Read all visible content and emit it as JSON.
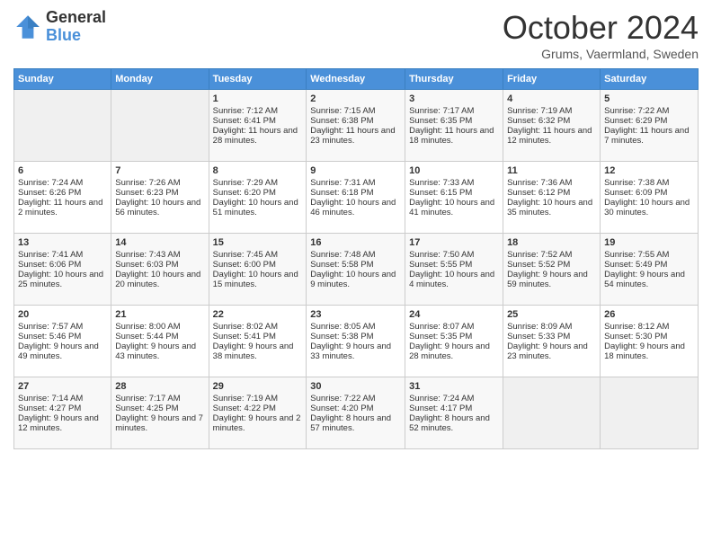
{
  "header": {
    "logo_line1": "General",
    "logo_line2": "Blue",
    "month": "October 2024",
    "location": "Grums, Vaermland, Sweden"
  },
  "days_of_week": [
    "Sunday",
    "Monday",
    "Tuesday",
    "Wednesday",
    "Thursday",
    "Friday",
    "Saturday"
  ],
  "weeks": [
    [
      {
        "day": "",
        "empty": true
      },
      {
        "day": "",
        "empty": true
      },
      {
        "day": "1",
        "sunrise": "Sunrise: 7:12 AM",
        "sunset": "Sunset: 6:41 PM",
        "daylight": "Daylight: 11 hours and 28 minutes."
      },
      {
        "day": "2",
        "sunrise": "Sunrise: 7:15 AM",
        "sunset": "Sunset: 6:38 PM",
        "daylight": "Daylight: 11 hours and 23 minutes."
      },
      {
        "day": "3",
        "sunrise": "Sunrise: 7:17 AM",
        "sunset": "Sunset: 6:35 PM",
        "daylight": "Daylight: 11 hours and 18 minutes."
      },
      {
        "day": "4",
        "sunrise": "Sunrise: 7:19 AM",
        "sunset": "Sunset: 6:32 PM",
        "daylight": "Daylight: 11 hours and 12 minutes."
      },
      {
        "day": "5",
        "sunrise": "Sunrise: 7:22 AM",
        "sunset": "Sunset: 6:29 PM",
        "daylight": "Daylight: 11 hours and 7 minutes."
      }
    ],
    [
      {
        "day": "6",
        "sunrise": "Sunrise: 7:24 AM",
        "sunset": "Sunset: 6:26 PM",
        "daylight": "Daylight: 11 hours and 2 minutes."
      },
      {
        "day": "7",
        "sunrise": "Sunrise: 7:26 AM",
        "sunset": "Sunset: 6:23 PM",
        "daylight": "Daylight: 10 hours and 56 minutes."
      },
      {
        "day": "8",
        "sunrise": "Sunrise: 7:29 AM",
        "sunset": "Sunset: 6:20 PM",
        "daylight": "Daylight: 10 hours and 51 minutes."
      },
      {
        "day": "9",
        "sunrise": "Sunrise: 7:31 AM",
        "sunset": "Sunset: 6:18 PM",
        "daylight": "Daylight: 10 hours and 46 minutes."
      },
      {
        "day": "10",
        "sunrise": "Sunrise: 7:33 AM",
        "sunset": "Sunset: 6:15 PM",
        "daylight": "Daylight: 10 hours and 41 minutes."
      },
      {
        "day": "11",
        "sunrise": "Sunrise: 7:36 AM",
        "sunset": "Sunset: 6:12 PM",
        "daylight": "Daylight: 10 hours and 35 minutes."
      },
      {
        "day": "12",
        "sunrise": "Sunrise: 7:38 AM",
        "sunset": "Sunset: 6:09 PM",
        "daylight": "Daylight: 10 hours and 30 minutes."
      }
    ],
    [
      {
        "day": "13",
        "sunrise": "Sunrise: 7:41 AM",
        "sunset": "Sunset: 6:06 PM",
        "daylight": "Daylight: 10 hours and 25 minutes."
      },
      {
        "day": "14",
        "sunrise": "Sunrise: 7:43 AM",
        "sunset": "Sunset: 6:03 PM",
        "daylight": "Daylight: 10 hours and 20 minutes."
      },
      {
        "day": "15",
        "sunrise": "Sunrise: 7:45 AM",
        "sunset": "Sunset: 6:00 PM",
        "daylight": "Daylight: 10 hours and 15 minutes."
      },
      {
        "day": "16",
        "sunrise": "Sunrise: 7:48 AM",
        "sunset": "Sunset: 5:58 PM",
        "daylight": "Daylight: 10 hours and 9 minutes."
      },
      {
        "day": "17",
        "sunrise": "Sunrise: 7:50 AM",
        "sunset": "Sunset: 5:55 PM",
        "daylight": "Daylight: 10 hours and 4 minutes."
      },
      {
        "day": "18",
        "sunrise": "Sunrise: 7:52 AM",
        "sunset": "Sunset: 5:52 PM",
        "daylight": "Daylight: 9 hours and 59 minutes."
      },
      {
        "day": "19",
        "sunrise": "Sunrise: 7:55 AM",
        "sunset": "Sunset: 5:49 PM",
        "daylight": "Daylight: 9 hours and 54 minutes."
      }
    ],
    [
      {
        "day": "20",
        "sunrise": "Sunrise: 7:57 AM",
        "sunset": "Sunset: 5:46 PM",
        "daylight": "Daylight: 9 hours and 49 minutes."
      },
      {
        "day": "21",
        "sunrise": "Sunrise: 8:00 AM",
        "sunset": "Sunset: 5:44 PM",
        "daylight": "Daylight: 9 hours and 43 minutes."
      },
      {
        "day": "22",
        "sunrise": "Sunrise: 8:02 AM",
        "sunset": "Sunset: 5:41 PM",
        "daylight": "Daylight: 9 hours and 38 minutes."
      },
      {
        "day": "23",
        "sunrise": "Sunrise: 8:05 AM",
        "sunset": "Sunset: 5:38 PM",
        "daylight": "Daylight: 9 hours and 33 minutes."
      },
      {
        "day": "24",
        "sunrise": "Sunrise: 8:07 AM",
        "sunset": "Sunset: 5:35 PM",
        "daylight": "Daylight: 9 hours and 28 minutes."
      },
      {
        "day": "25",
        "sunrise": "Sunrise: 8:09 AM",
        "sunset": "Sunset: 5:33 PM",
        "daylight": "Daylight: 9 hours and 23 minutes."
      },
      {
        "day": "26",
        "sunrise": "Sunrise: 8:12 AM",
        "sunset": "Sunset: 5:30 PM",
        "daylight": "Daylight: 9 hours and 18 minutes."
      }
    ],
    [
      {
        "day": "27",
        "sunrise": "Sunrise: 7:14 AM",
        "sunset": "Sunset: 4:27 PM",
        "daylight": "Daylight: 9 hours and 12 minutes."
      },
      {
        "day": "28",
        "sunrise": "Sunrise: 7:17 AM",
        "sunset": "Sunset: 4:25 PM",
        "daylight": "Daylight: 9 hours and 7 minutes."
      },
      {
        "day": "29",
        "sunrise": "Sunrise: 7:19 AM",
        "sunset": "Sunset: 4:22 PM",
        "daylight": "Daylight: 9 hours and 2 minutes."
      },
      {
        "day": "30",
        "sunrise": "Sunrise: 7:22 AM",
        "sunset": "Sunset: 4:20 PM",
        "daylight": "Daylight: 8 hours and 57 minutes."
      },
      {
        "day": "31",
        "sunrise": "Sunrise: 7:24 AM",
        "sunset": "Sunset: 4:17 PM",
        "daylight": "Daylight: 8 hours and 52 minutes."
      },
      {
        "day": "",
        "empty": true
      },
      {
        "day": "",
        "empty": true
      }
    ]
  ]
}
